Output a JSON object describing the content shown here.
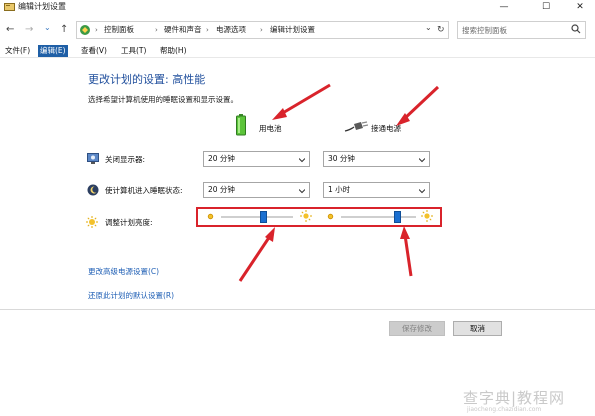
{
  "window": {
    "title": "编辑计划设置",
    "controls": {
      "minimize": "—",
      "maximize": "☐",
      "close": "✕"
    }
  },
  "nav": {
    "back": "←",
    "forward": "→",
    "history": "⌄",
    "up": "↑",
    "refresh": "↻",
    "breadcrumb": [
      "控制面板",
      "硬件和声音",
      "电源选项",
      "编辑计划设置"
    ],
    "breadcrumb_sep": "›",
    "dropdown": "⌄"
  },
  "search": {
    "placeholder": "搜索控制面板",
    "icon": "search-icon"
  },
  "menu": {
    "items": [
      "文件(F)",
      "编辑(E)",
      "查看(V)",
      "工具(T)",
      "帮助(H)"
    ],
    "active_index": 1
  },
  "plan": {
    "heading": "更改计划的设置: 高性能",
    "subheading": "选择希望计算机使用的睡眠设置和显示设置。",
    "columns": {
      "battery": "用电池",
      "plugged": "接通电源"
    }
  },
  "settings": {
    "display_off": {
      "label": "关闭显示器:",
      "battery": "20 分钟",
      "plugged": "30 分钟"
    },
    "sleep": {
      "label": "使计算机进入睡眠状态:",
      "battery": "20 分钟",
      "plugged": "1 小时"
    },
    "brightness": {
      "label": "调整计划亮度:",
      "battery_level": 0.6,
      "plugged_level": 0.78
    }
  },
  "links": {
    "advanced": "更改高级电源设置(C)",
    "restore": "还原此计划的默认设置(R)"
  },
  "buttons": {
    "save": "保存修改",
    "cancel": "取消"
  },
  "watermark": {
    "big": "查字典|教程网",
    "small": "jiaocheng.chazidian.com"
  },
  "colors": {
    "accent": "#1f5fa6",
    "heading": "#1f4e9c",
    "link": "#1f5fb5",
    "annotation_red": "#d9232b",
    "slider_thumb": "#1a6fd0"
  }
}
